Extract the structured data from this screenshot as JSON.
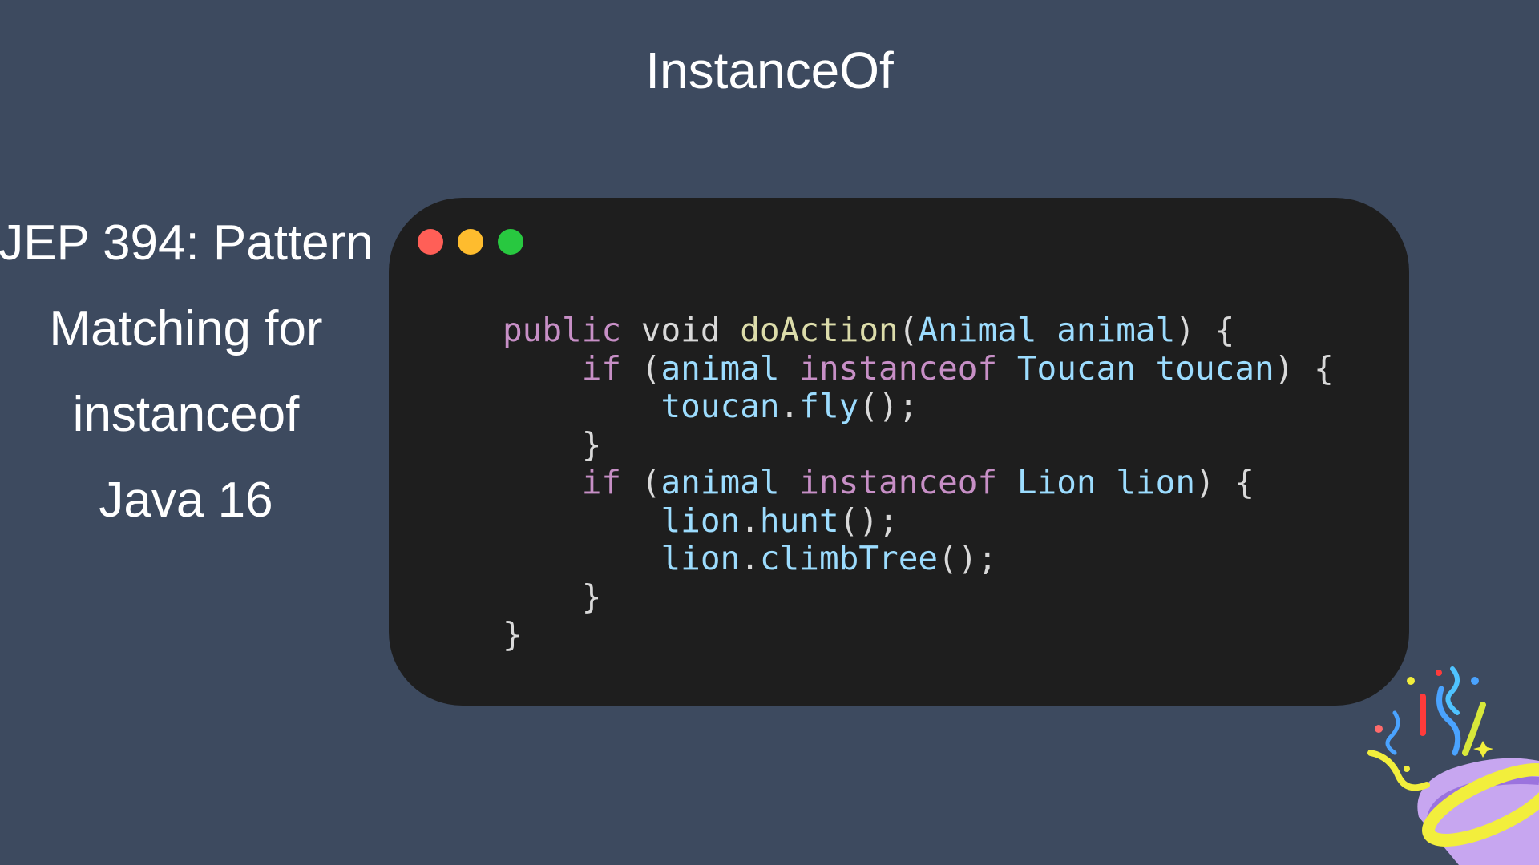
{
  "slide": {
    "title": "InstanceOf",
    "subtitle_lines": [
      "JEP 394: Pattern",
      "Matching for",
      "instanceof",
      "Java 16"
    ]
  },
  "colors": {
    "background": "#3d4a5f",
    "code_bg": "#1e1e1e",
    "keyword": "#c78fc6",
    "plain": "#d9d9d9",
    "function": "#dcdcaa",
    "identifier": "#9cdcfe",
    "type": "#4ec9b0"
  },
  "window_controls": [
    "close-dot",
    "minimize-dot",
    "maximize-dot"
  ],
  "code_lines": [
    [
      {
        "text": "public",
        "color": "#c78fc6"
      },
      {
        "text": " void ",
        "color": "#d9d9d9"
      },
      {
        "text": "doAction",
        "color": "#dcdcaa"
      },
      {
        "text": "(",
        "color": "#d9d9d9"
      },
      {
        "text": "Animal",
        "color": "#9cdcfe"
      },
      {
        "text": " ",
        "color": "#d9d9d9"
      },
      {
        "text": "animal",
        "color": "#9cdcfe"
      },
      {
        "text": ") {",
        "color": "#d9d9d9"
      }
    ],
    [
      {
        "text": "    ",
        "color": "#d9d9d9"
      },
      {
        "text": "if",
        "color": "#c78fc6"
      },
      {
        "text": " (",
        "color": "#d9d9d9"
      },
      {
        "text": "animal",
        "color": "#9cdcfe"
      },
      {
        "text": " ",
        "color": "#d9d9d9"
      },
      {
        "text": "instanceof",
        "color": "#c78fc6"
      },
      {
        "text": " ",
        "color": "#d9d9d9"
      },
      {
        "text": "Toucan",
        "color": "#9cdcfe"
      },
      {
        "text": " ",
        "color": "#d9d9d9"
      },
      {
        "text": "toucan",
        "color": "#9cdcfe"
      },
      {
        "text": ") {",
        "color": "#d9d9d9"
      }
    ],
    [
      {
        "text": "        ",
        "color": "#d9d9d9"
      },
      {
        "text": "toucan",
        "color": "#9cdcfe"
      },
      {
        "text": ".",
        "color": "#d9d9d9"
      },
      {
        "text": "fly",
        "color": "#9cdcfe"
      },
      {
        "text": "();",
        "color": "#d9d9d9"
      }
    ],
    [
      {
        "text": "    }",
        "color": "#d9d9d9"
      }
    ],
    [
      {
        "text": "    ",
        "color": "#d9d9d9"
      },
      {
        "text": "if",
        "color": "#c78fc6"
      },
      {
        "text": " (",
        "color": "#d9d9d9"
      },
      {
        "text": "animal",
        "color": "#9cdcfe"
      },
      {
        "text": " ",
        "color": "#d9d9d9"
      },
      {
        "text": "instanceof",
        "color": "#c78fc6"
      },
      {
        "text": " ",
        "color": "#d9d9d9"
      },
      {
        "text": "Lion",
        "color": "#9cdcfe"
      },
      {
        "text": " ",
        "color": "#d9d9d9"
      },
      {
        "text": "lion",
        "color": "#9cdcfe"
      },
      {
        "text": ") {",
        "color": "#d9d9d9"
      }
    ],
    [
      {
        "text": "        ",
        "color": "#d9d9d9"
      },
      {
        "text": "lion",
        "color": "#9cdcfe"
      },
      {
        "text": ".",
        "color": "#d9d9d9"
      },
      {
        "text": "hunt",
        "color": "#9cdcfe"
      },
      {
        "text": "();",
        "color": "#d9d9d9"
      }
    ],
    [
      {
        "text": "        ",
        "color": "#d9d9d9"
      },
      {
        "text": "lion",
        "color": "#9cdcfe"
      },
      {
        "text": ".",
        "color": "#d9d9d9"
      },
      {
        "text": "climbTree",
        "color": "#9cdcfe"
      },
      {
        "text": "();",
        "color": "#d9d9d9"
      }
    ],
    [
      {
        "text": "    }",
        "color": "#d9d9d9"
      }
    ],
    [
      {
        "text": "}",
        "color": "#d9d9d9"
      }
    ]
  ],
  "decoration": {
    "icon": "party-popper-icon"
  }
}
